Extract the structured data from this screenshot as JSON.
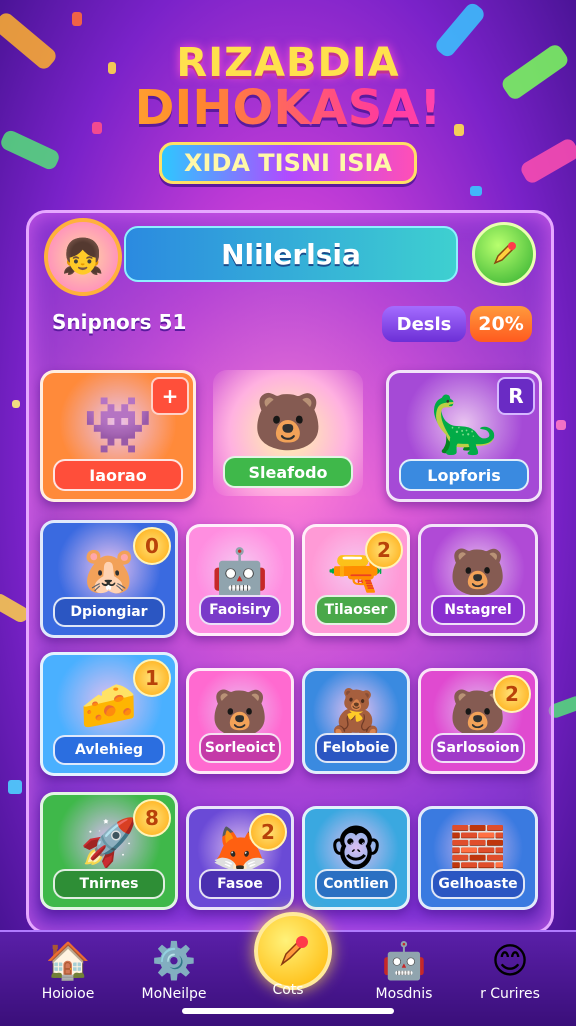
{
  "logo": {
    "line1": "RIZABDIA",
    "line2": "DIHOKASA!",
    "subtitle": "XIDA TISNI ISIA"
  },
  "profile": {
    "avatar_icon": "girl-avatar-icon",
    "player_name": "Nlilerlsia",
    "edit_icon": "pencil-icon"
  },
  "stats": {
    "label": "Snipnors 51",
    "deals_label": "Desls",
    "percent": "20%"
  },
  "cards": [
    {
      "label": "Iaorao",
      "badge": "+",
      "badge_style": "red",
      "icon": "green-monster-icon",
      "bg": "#ff8a3a",
      "label_bg": "#ff4e3a"
    },
    {
      "label": "Sleafodo",
      "badge": "",
      "badge_style": "",
      "icon": "pink-bear-icon",
      "bg": "transparent",
      "label_bg": "#3fb84a"
    },
    {
      "label": "Lopforis",
      "badge": "R",
      "badge_style": "purple",
      "icon": "blue-dino-icon",
      "bg": "#a54ad6",
      "label_bg": "#3a8ae0"
    },
    {
      "label": "Dpiongiar",
      "badge": "0",
      "badge_style": "gold",
      "icon": "orange-creature-icon",
      "bg": "#3a6ae0",
      "label_bg": "#2b56c2"
    },
    {
      "label": "Faoisiry",
      "badge": "",
      "badge_style": "",
      "icon": "purple-robot-icon",
      "bg": "#ff8ee0",
      "label_bg": "#7a3ac9"
    },
    {
      "label": "Tilaoser",
      "badge": "2",
      "badge_style": "gold",
      "icon": "green-blaster-icon",
      "bg": "#ff9ad6",
      "label_bg": "#4aa84a"
    },
    {
      "label": "Nstagrel",
      "badge": "",
      "badge_style": "",
      "icon": "bear-duo-icon",
      "bg": "#b04ad6",
      "label_bg": "#8a2fd0"
    },
    {
      "label": "Avlehieg",
      "badge": "1",
      "badge_style": "gold",
      "icon": "cheese-hammer-icon",
      "bg": "#4ab0ff",
      "label_bg": "#2b6ee0"
    },
    {
      "label": "Sorleoict",
      "badge": "",
      "badge_style": "",
      "icon": "bear-cub-icon",
      "bg": "#ff6ad0",
      "label_bg": "#c43aa8"
    },
    {
      "label": "Feloboie",
      "badge": "",
      "badge_style": "",
      "icon": "teddy-bear-icon",
      "bg": "#3a8ae0",
      "label_bg": "#2b56c2"
    },
    {
      "label": "Sarlosoion",
      "badge": "2",
      "badge_style": "gold",
      "icon": "blue-bear-icon",
      "bg": "#e04ad0",
      "label_bg": "#a03ac9"
    },
    {
      "label": "Tnirnes",
      "badge": "8",
      "badge_style": "gold",
      "icon": "rocket-icon",
      "bg": "#3fb84a",
      "label_bg": "#2e8e36"
    },
    {
      "label": "Fasoe",
      "badge": "2",
      "badge_style": "gold",
      "icon": "fox-pilot-icon",
      "bg": "#6a4ad6",
      "label_bg": "#4a2fb0"
    },
    {
      "label": "Contlien",
      "badge": "",
      "badge_style": "",
      "icon": "monkey-icon",
      "bg": "#3aa8e0",
      "label_bg": "#2b70c2"
    },
    {
      "label": "Gelhoaste",
      "badge": "",
      "badge_style": "",
      "icon": "rainbow-blocks-icon",
      "bg": "#3a7ae0",
      "label_bg": "#2b56c2"
    }
  ],
  "nav": {
    "items": [
      {
        "label": "Hoioioe",
        "icon": "home-icon"
      },
      {
        "label": "MoNeilpe",
        "icon": "gear-icon"
      },
      {
        "label": "Mosdnis",
        "icon": "robot-icon"
      },
      {
        "label": "r Curires",
        "icon": "smiley-icon"
      }
    ],
    "center": {
      "label": "Cots",
      "icon": "play-brush-icon"
    }
  }
}
